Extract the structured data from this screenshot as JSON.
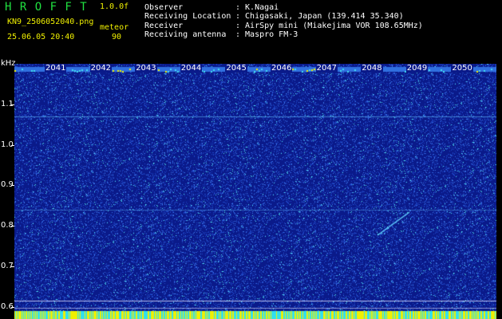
{
  "header": {
    "title": "H R O F F T",
    "version": "1.0.0f",
    "filename": "KN9_2506052040.png",
    "datetime": "25.06.05 20:40",
    "label_meteor": "meteor",
    "count": "90",
    "info_lines": [
      {
        "label": "Observer",
        "value": ": K.Nagai"
      },
      {
        "label": "Receiving Location",
        "value": ": Chigasaki, Japan (139.414 35.340)"
      },
      {
        "label": "Receiver",
        "value": ": AirSpy mini (Miakejima VOR 108.65MHz)"
      },
      {
        "label": "Receiving antenna",
        "value": ": Maspro FM-3"
      }
    ]
  },
  "chart_data": {
    "type": "heatmap",
    "ylabel": "kHz",
    "ylim": [
      0.57,
      1.2
    ],
    "yticks": [
      "1.1",
      "1.0",
      "0.9",
      "0.8",
      "0.7",
      "0.6"
    ],
    "ytick_values": [
      1.1,
      1.0,
      0.9,
      0.8,
      0.7,
      0.6
    ],
    "time_labels": [
      "2041",
      "2042",
      "2043",
      "2044",
      "2045",
      "2046",
      "2047",
      "2048",
      "2049",
      "2050"
    ],
    "colors": {
      "background": "#0a1a8a",
      "noise": "#3a6ae0",
      "signal": "#40e0f0",
      "strong": "#f0f000"
    }
  }
}
